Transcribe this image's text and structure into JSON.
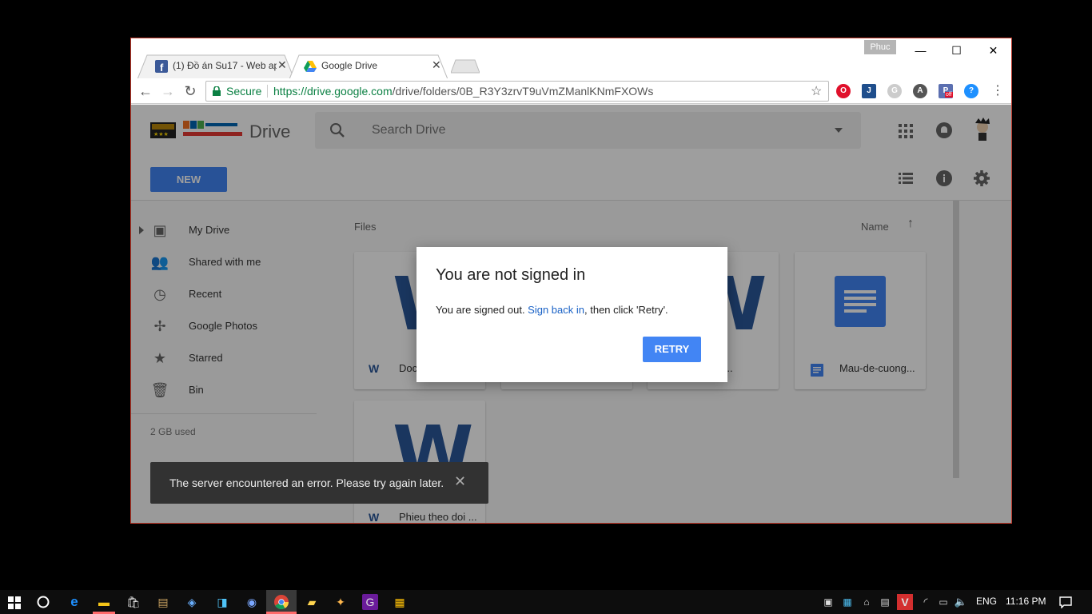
{
  "browser": {
    "profile_name": "Phuc",
    "tabs": [
      {
        "title": "(1) Đồ án Su17 - Web ap",
        "favicon": "facebook-icon",
        "active": false
      },
      {
        "title": "Google Drive",
        "favicon": "google-drive-icon",
        "active": true
      }
    ],
    "omnibox": {
      "secure_label": "Secure",
      "url_host": "https://drive.google.com",
      "url_path": "/drive/folders/0B_R3Y3zrvT9uVmZManlKNmFXOWs"
    },
    "extensions": [
      {
        "name": "opera-icon",
        "color": "#e0102b"
      },
      {
        "name": "j-extension-icon",
        "color": "#1f4e8c"
      },
      {
        "name": "grey-circle-icon",
        "color": "#bbbbbb"
      },
      {
        "name": "a-extension-icon",
        "color": "#555555"
      },
      {
        "name": "off-badge-extension-icon",
        "color": "#5b6fb0",
        "badge": "off"
      },
      {
        "name": "blue-extension-icon",
        "color": "#1e90ff"
      }
    ]
  },
  "drive": {
    "product_name": "Drive",
    "search_placeholder": "Search Drive",
    "new_button": "NEW",
    "sidebar": [
      {
        "label": "My Drive",
        "icon": "my-drive-icon"
      },
      {
        "label": "Shared with me",
        "icon": "people-icon"
      },
      {
        "label": "Recent",
        "icon": "clock-icon"
      },
      {
        "label": "Google Photos",
        "icon": "pinwheel-icon"
      },
      {
        "label": "Starred",
        "icon": "star-icon"
      },
      {
        "label": "Bin",
        "icon": "trash-icon"
      }
    ],
    "storage_used": "2 GB used",
    "files_heading": "Files",
    "sort_label": "Name",
    "files": [
      {
        "name": "Doc",
        "type": "word"
      },
      {
        "name": "",
        "type": "word"
      },
      {
        "name": "-cuong...",
        "type": "word"
      },
      {
        "name": "Mau-de-cuong...",
        "type": "gdoc"
      },
      {
        "name": "Phieu theo doi ...",
        "type": "word"
      }
    ]
  },
  "dialog": {
    "title": "You are not signed in",
    "msg_prefix": "You are signed out. ",
    "msg_link": "Sign back in",
    "msg_suffix": ", then click 'Retry'.",
    "retry_button": "RETRY"
  },
  "snackbar": {
    "message": "The server encountered an error. Please try again later."
  },
  "taskbar": {
    "language": "ENG",
    "time": "11:16 PM"
  },
  "colors": {
    "accent": "#4285f4",
    "word_blue": "#2b579a",
    "secure_green": "#0b8043"
  }
}
